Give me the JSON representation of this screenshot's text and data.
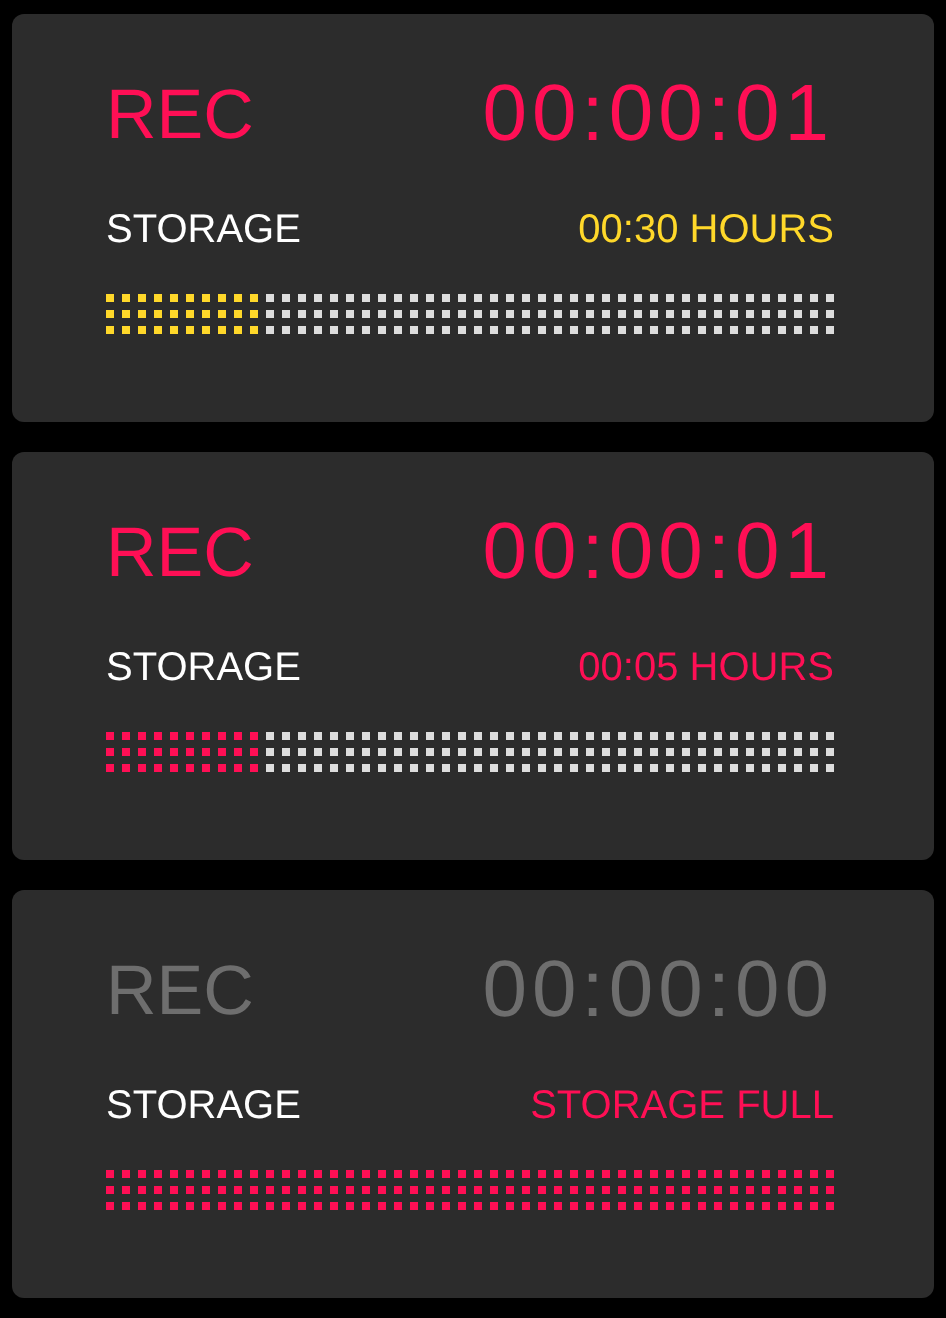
{
  "cards": [
    {
      "label": "REC",
      "recording": true,
      "timer": "00:00:01",
      "storage_label": "STORAGE",
      "remaining": "00:30 HOURS",
      "color": "#ffd82a",
      "level": 0.217
    },
    {
      "label": "REC",
      "recording": true,
      "timer": "00:00:01",
      "storage_label": "STORAGE",
      "remaining": "00:05 HOURS",
      "color": "#ff0f55",
      "level": 0.217
    },
    {
      "label": "REC",
      "recording": false,
      "timer": "00:00:00",
      "storage_label": "STORAGE",
      "remaining": "STORAGE FULL",
      "color": "#ff0f55",
      "level": 1
    }
  ]
}
